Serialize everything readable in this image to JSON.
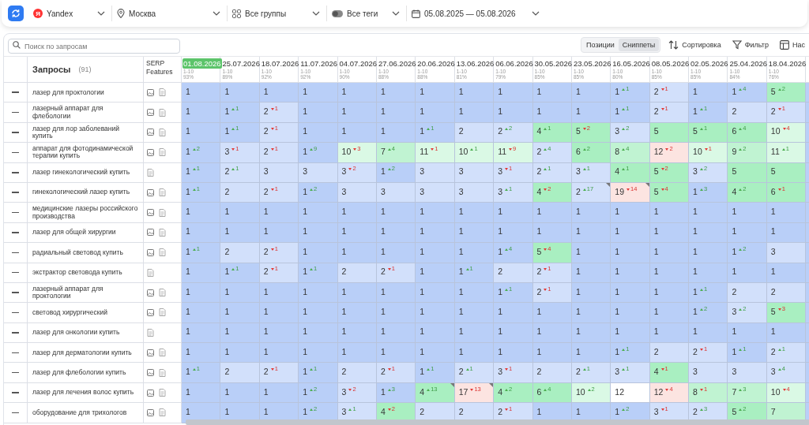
{
  "filters": [
    {
      "kind": "engine",
      "logo": "Я",
      "label": "Yandex"
    },
    {
      "kind": "location",
      "label": "Москва"
    },
    {
      "kind": "groups",
      "label": "Все группы"
    },
    {
      "kind": "tags",
      "label": "Все теги"
    },
    {
      "kind": "dates",
      "label": "05.08.2025 — 05.08.2026"
    }
  ],
  "search": {
    "placeholder": "Поиск по запросам"
  },
  "view_tabs": [
    {
      "label": "Позиции",
      "selected": false
    },
    {
      "label": "Сниппеты",
      "selected": true
    }
  ],
  "actions": [
    {
      "kind": "sort",
      "label": "Сортировка"
    },
    {
      "kind": "filter",
      "label": "Фильтр"
    },
    {
      "kind": "columns",
      "label": "Нас"
    }
  ],
  "table": {
    "query_heading": "Запросы",
    "query_count": "(91)",
    "serp_heading": "SERP Features",
    "columns": [
      {
        "date": "01.08.2026",
        "range": "1-10",
        "share": "93%",
        "selected": true
      },
      {
        "date": "25.07.2026",
        "range": "1-10",
        "share": "89%",
        "selected": false
      },
      {
        "date": "18.07.2026",
        "range": "1-10",
        "share": "92%",
        "selected": false
      },
      {
        "date": "11.07.2026",
        "range": "1-10",
        "share": "92%",
        "selected": false
      },
      {
        "date": "04.07.2026",
        "range": "1-10",
        "share": "90%",
        "selected": false
      },
      {
        "date": "27.06.2026",
        "range": "1-10",
        "share": "88%",
        "selected": false
      },
      {
        "date": "20.06.2026",
        "range": "1-10",
        "share": "88%",
        "selected": false
      },
      {
        "date": "13.06.2026",
        "range": "1-10",
        "share": "81%",
        "selected": false
      },
      {
        "date": "06.06.2026",
        "range": "1-10",
        "share": "79%",
        "selected": false
      },
      {
        "date": "30.05.2026",
        "range": "1-10",
        "share": "85%",
        "selected": false
      },
      {
        "date": "23.05.2026",
        "range": "1-10",
        "share": "85%",
        "selected": false
      },
      {
        "date": "16.05.2026",
        "range": "1-10",
        "share": "80%",
        "selected": false
      },
      {
        "date": "08.05.2026",
        "range": "1-10",
        "share": "85%",
        "selected": false
      },
      {
        "date": "02.05.2026",
        "range": "1-10",
        "share": "85%",
        "selected": false
      },
      {
        "date": "25.04.2026",
        "range": "1-10",
        "share": "84%",
        "selected": false
      },
      {
        "date": "18.04.2026",
        "range": "1-10",
        "share": "76%",
        "selected": false
      }
    ],
    "rows": [
      {
        "query": "лазер для проктологии",
        "images": true,
        "cells": [
          {
            "value": "1"
          },
          {
            "value": "1"
          },
          {
            "value": "1"
          },
          {
            "value": "1"
          },
          {
            "value": "1"
          },
          {
            "value": "1"
          },
          {
            "value": "1"
          },
          {
            "value": "1"
          },
          {
            "value": "1"
          },
          {
            "value": "1"
          },
          {
            "value": "1"
          },
          {
            "value": "1",
            "delta": "1",
            "rising": true
          },
          {
            "value": "2",
            "delta": "1",
            "rising": false
          },
          {
            "value": "1"
          },
          {
            "value": "1",
            "delta": "4",
            "rising": true
          },
          {
            "value": "5",
            "delta": "2",
            "rising": true
          }
        ]
      },
      {
        "query": "лазерный аппарат для флебологии",
        "images": true,
        "cells": [
          {
            "value": "1"
          },
          {
            "value": "1",
            "delta": "1",
            "rising": true
          },
          {
            "value": "2",
            "delta": "1",
            "rising": false
          },
          {
            "value": "1"
          },
          {
            "value": "1"
          },
          {
            "value": "1"
          },
          {
            "value": "1"
          },
          {
            "value": "1"
          },
          {
            "value": "1"
          },
          {
            "value": "1"
          },
          {
            "value": "1"
          },
          {
            "value": "1",
            "delta": "1",
            "rising": true
          },
          {
            "value": "2",
            "delta": "1",
            "rising": false
          },
          {
            "value": "1",
            "delta": "1",
            "rising": true
          },
          {
            "value": "2"
          },
          {
            "value": "2",
            "delta": "1",
            "rising": false
          }
        ]
      },
      {
        "query": "лазер для лор заболеваний купить",
        "images": true,
        "cells": [
          {
            "value": "1"
          },
          {
            "value": "1",
            "delta": "1",
            "rising": true
          },
          {
            "value": "2",
            "delta": "1",
            "rising": false
          },
          {
            "value": "1"
          },
          {
            "value": "1"
          },
          {
            "value": "1"
          },
          {
            "value": "1",
            "delta": "1",
            "rising": true
          },
          {
            "value": "2"
          },
          {
            "value": "2",
            "delta": "2",
            "rising": true
          },
          {
            "value": "4",
            "delta": "1",
            "rising": true
          },
          {
            "value": "5",
            "delta": "2",
            "rising": false
          },
          {
            "value": "3",
            "delta": "2",
            "rising": true
          },
          {
            "value": "5"
          },
          {
            "value": "5",
            "delta": "1",
            "rising": true
          },
          {
            "value": "6",
            "delta": "4",
            "rising": true
          },
          {
            "value": "10",
            "delta": "4",
            "rising": false
          }
        ]
      },
      {
        "query": "аппарат для фотодинамической терапии купить",
        "images": true,
        "cells": [
          {
            "value": "1",
            "delta": "2",
            "rising": true
          },
          {
            "value": "3",
            "delta": "1",
            "rising": false
          },
          {
            "value": "2",
            "delta": "1",
            "rising": false
          },
          {
            "value": "1",
            "delta": "9",
            "rising": true
          },
          {
            "value": "10",
            "delta": "3",
            "rising": false
          },
          {
            "value": "7",
            "delta": "4",
            "rising": true
          },
          {
            "value": "11",
            "delta": "1",
            "rising": false
          },
          {
            "value": "10",
            "delta": "1",
            "rising": true
          },
          {
            "value": "11",
            "delta": "9",
            "rising": false
          },
          {
            "value": "2",
            "delta": "4",
            "rising": true
          },
          {
            "value": "6",
            "delta": "2",
            "rising": true
          },
          {
            "value": "8",
            "delta": "4",
            "rising": true
          },
          {
            "value": "12",
            "delta": "2",
            "rising": false
          },
          {
            "value": "10",
            "delta": "1",
            "rising": false
          },
          {
            "value": "9",
            "delta": "2",
            "rising": true
          },
          {
            "value": "11",
            "delta": "1",
            "rising": true
          }
        ]
      },
      {
        "query": "лазер гинекологический купить",
        "images": false,
        "cells": [
          {
            "value": "1",
            "delta": "1",
            "rising": true
          },
          {
            "value": "2",
            "delta": "1",
            "rising": true
          },
          {
            "value": "3"
          },
          {
            "value": "3"
          },
          {
            "value": "3",
            "delta": "2",
            "rising": false
          },
          {
            "value": "1",
            "delta": "2",
            "rising": true
          },
          {
            "value": "3"
          },
          {
            "value": "3"
          },
          {
            "value": "3",
            "delta": "1",
            "rising": false
          },
          {
            "value": "2",
            "delta": "1",
            "rising": true
          },
          {
            "value": "3",
            "delta": "1",
            "rising": true
          },
          {
            "value": "4",
            "delta": "1",
            "rising": true
          },
          {
            "value": "5",
            "delta": "2",
            "rising": false
          },
          {
            "value": "3",
            "delta": "2",
            "rising": true
          },
          {
            "value": "5"
          },
          {
            "value": "5"
          }
        ]
      },
      {
        "query": "гинекологический лазер купить",
        "images": true,
        "cells": [
          {
            "value": "1",
            "delta": "1",
            "rising": true
          },
          {
            "value": "2"
          },
          {
            "value": "2",
            "delta": "1",
            "rising": false
          },
          {
            "value": "1",
            "delta": "2",
            "rising": true
          },
          {
            "value": "3"
          },
          {
            "value": "3"
          },
          {
            "value": "3"
          },
          {
            "value": "3"
          },
          {
            "value": "3",
            "delta": "1",
            "rising": true
          },
          {
            "value": "4",
            "delta": "2",
            "rising": false
          },
          {
            "value": "2",
            "delta": "17",
            "rising": true,
            "flagged": true
          },
          {
            "value": "19",
            "delta": "14",
            "rising": false,
            "flagged": true
          },
          {
            "value": "5",
            "delta": "4",
            "rising": false
          },
          {
            "value": "1",
            "delta": "3",
            "rising": true
          },
          {
            "value": "4",
            "delta": "2",
            "rising": true
          },
          {
            "value": "6",
            "delta": "1",
            "rising": false
          }
        ]
      },
      {
        "query": "медицинские лазеры российского производства",
        "images": true,
        "cells": [
          {
            "value": "1"
          },
          {
            "value": "1"
          },
          {
            "value": "1"
          },
          {
            "value": "1"
          },
          {
            "value": "1"
          },
          {
            "value": "1"
          },
          {
            "value": "1"
          },
          {
            "value": "1"
          },
          {
            "value": "1"
          },
          {
            "value": "1"
          },
          {
            "value": "1"
          },
          {
            "value": "1"
          },
          {
            "value": "1"
          },
          {
            "value": "1"
          },
          {
            "value": "1"
          },
          {
            "value": "1"
          }
        ]
      },
      {
        "query": "лазер для общей хирургии",
        "images": true,
        "cells": [
          {
            "value": "1"
          },
          {
            "value": "1"
          },
          {
            "value": "1"
          },
          {
            "value": "1"
          },
          {
            "value": "1"
          },
          {
            "value": "1"
          },
          {
            "value": "1"
          },
          {
            "value": "1"
          },
          {
            "value": "1"
          },
          {
            "value": "1"
          },
          {
            "value": "1"
          },
          {
            "value": "1"
          },
          {
            "value": "1"
          },
          {
            "value": "1"
          },
          {
            "value": "1"
          },
          {
            "value": "1"
          }
        ]
      },
      {
        "query": "радиальный световод купить",
        "images": true,
        "cells": [
          {
            "value": "1",
            "delta": "1",
            "rising": true
          },
          {
            "value": "2"
          },
          {
            "value": "2",
            "delta": "1",
            "rising": false
          },
          {
            "value": "1"
          },
          {
            "value": "1"
          },
          {
            "value": "1"
          },
          {
            "value": "1"
          },
          {
            "value": "1"
          },
          {
            "value": "1",
            "delta": "4",
            "rising": true
          },
          {
            "value": "5",
            "delta": "4",
            "rising": false
          },
          {
            "value": "1"
          },
          {
            "value": "1"
          },
          {
            "value": "1"
          },
          {
            "value": "1"
          },
          {
            "value": "1",
            "delta": "2",
            "rising": true
          },
          {
            "value": "3"
          }
        ]
      },
      {
        "query": "экстрактор световода купить",
        "images": false,
        "cells": [
          {
            "value": "1"
          },
          {
            "value": "1",
            "delta": "1",
            "rising": true
          },
          {
            "value": "2",
            "delta": "1",
            "rising": false
          },
          {
            "value": "1",
            "delta": "1",
            "rising": true
          },
          {
            "value": "2"
          },
          {
            "value": "2",
            "delta": "1",
            "rising": false
          },
          {
            "value": "1"
          },
          {
            "value": "1",
            "delta": "1",
            "rising": true
          },
          {
            "value": "2"
          },
          {
            "value": "2",
            "delta": "1",
            "rising": false
          },
          {
            "value": "1"
          },
          {
            "value": "1"
          },
          {
            "value": "1"
          },
          {
            "value": "1"
          },
          {
            "value": "1"
          },
          {
            "value": "1"
          }
        ]
      },
      {
        "query": "лазерный аппарат для проктологии",
        "images": true,
        "cells": [
          {
            "value": "1"
          },
          {
            "value": "1"
          },
          {
            "value": "1"
          },
          {
            "value": "1"
          },
          {
            "value": "1"
          },
          {
            "value": "1"
          },
          {
            "value": "1"
          },
          {
            "value": "1"
          },
          {
            "value": "1",
            "delta": "1",
            "rising": true
          },
          {
            "value": "2",
            "delta": "1",
            "rising": false
          },
          {
            "value": "1"
          },
          {
            "value": "1"
          },
          {
            "value": "1"
          },
          {
            "value": "1",
            "delta": "1",
            "rising": true
          },
          {
            "value": "2"
          },
          {
            "value": "2"
          }
        ]
      },
      {
        "query": "световод хирургический",
        "images": true,
        "cells": [
          {
            "value": "1"
          },
          {
            "value": "1"
          },
          {
            "value": "1"
          },
          {
            "value": "1"
          },
          {
            "value": "1"
          },
          {
            "value": "1"
          },
          {
            "value": "1"
          },
          {
            "value": "1"
          },
          {
            "value": "1"
          },
          {
            "value": "1"
          },
          {
            "value": "1"
          },
          {
            "value": "1"
          },
          {
            "value": "1"
          },
          {
            "value": "1",
            "delta": "2",
            "rising": true
          },
          {
            "value": "3",
            "delta": "2",
            "rising": true
          },
          {
            "value": "5",
            "delta": "3",
            "rising": false
          }
        ]
      },
      {
        "query": "лазер для онкологии купить",
        "images": false,
        "cells": [
          {
            "value": "1"
          },
          {
            "value": "1"
          },
          {
            "value": "1"
          },
          {
            "value": "1"
          },
          {
            "value": "1"
          },
          {
            "value": "1"
          },
          {
            "value": "1"
          },
          {
            "value": "1"
          },
          {
            "value": "1"
          },
          {
            "value": "1"
          },
          {
            "value": "1"
          },
          {
            "value": "1"
          },
          {
            "value": "1"
          },
          {
            "value": "1"
          },
          {
            "value": "1"
          },
          {
            "value": "1"
          }
        ]
      },
      {
        "query": "лазер для дерматологии купить",
        "images": true,
        "cells": [
          {
            "value": "1"
          },
          {
            "value": "1"
          },
          {
            "value": "1"
          },
          {
            "value": "1"
          },
          {
            "value": "1"
          },
          {
            "value": "1"
          },
          {
            "value": "1"
          },
          {
            "value": "1"
          },
          {
            "value": "1"
          },
          {
            "value": "1"
          },
          {
            "value": "1"
          },
          {
            "value": "1",
            "delta": "1",
            "rising": true
          },
          {
            "value": "2"
          },
          {
            "value": "2",
            "delta": "1",
            "rising": false
          },
          {
            "value": "1",
            "delta": "1",
            "rising": true
          },
          {
            "value": "2",
            "delta": "1",
            "rising": true
          }
        ]
      },
      {
        "query": "лазер для флебологии купить",
        "images": true,
        "cells": [
          {
            "value": "1",
            "delta": "1",
            "rising": true
          },
          {
            "value": "2"
          },
          {
            "value": "2",
            "delta": "1",
            "rising": false
          },
          {
            "value": "1",
            "delta": "1",
            "rising": true
          },
          {
            "value": "2"
          },
          {
            "value": "2",
            "delta": "1",
            "rising": false
          },
          {
            "value": "1",
            "delta": "1",
            "rising": true
          },
          {
            "value": "2",
            "delta": "1",
            "rising": true
          },
          {
            "value": "3",
            "delta": "1",
            "rising": false
          },
          {
            "value": "2"
          },
          {
            "value": "2",
            "delta": "1",
            "rising": true
          },
          {
            "value": "3",
            "delta": "1",
            "rising": true
          },
          {
            "value": "4",
            "delta": "1",
            "rising": false
          },
          {
            "value": "3"
          },
          {
            "value": "3"
          },
          {
            "value": "3",
            "delta": "4",
            "rising": true
          }
        ]
      },
      {
        "query": "лазер для лечения волос купить",
        "images": true,
        "cells": [
          {
            "value": "1"
          },
          {
            "value": "1"
          },
          {
            "value": "1"
          },
          {
            "value": "1",
            "delta": "2",
            "rising": true
          },
          {
            "value": "3",
            "delta": "2",
            "rising": false
          },
          {
            "value": "1",
            "delta": "3",
            "rising": true
          },
          {
            "value": "4",
            "delta": "13",
            "rising": true,
            "flagged": true
          },
          {
            "value": "17",
            "delta": "13",
            "rising": false,
            "flagged": true
          },
          {
            "value": "4",
            "delta": "2",
            "rising": true
          },
          {
            "value": "6",
            "delta": "4",
            "rising": true
          },
          {
            "value": "10",
            "delta": "2",
            "rising": true
          },
          {
            "value": "12"
          },
          {
            "value": "12",
            "delta": "4",
            "rising": false
          },
          {
            "value": "8",
            "delta": "1",
            "rising": false
          },
          {
            "value": "7",
            "delta": "3",
            "rising": true
          },
          {
            "value": "10",
            "delta": "4",
            "rising": false
          }
        ]
      },
      {
        "query": "оборудование для трихологов",
        "images": true,
        "cells": [
          {
            "value": "1"
          },
          {
            "value": "1"
          },
          {
            "value": "1"
          },
          {
            "value": "1",
            "delta": "2",
            "rising": true
          },
          {
            "value": "3",
            "delta": "1",
            "rising": true
          },
          {
            "value": "4",
            "delta": "2",
            "rising": false
          },
          {
            "value": "2"
          },
          {
            "value": "2"
          },
          {
            "value": "2",
            "delta": "1",
            "rising": false
          },
          {
            "value": "1"
          },
          {
            "value": "1"
          },
          {
            "value": "1",
            "delta": "2",
            "rising": true
          },
          {
            "value": "3",
            "delta": "1",
            "rising": false
          },
          {
            "value": "2",
            "delta": "3",
            "rising": true
          },
          {
            "value": "5",
            "delta": "2",
            "rising": true
          },
          {
            "value": "7"
          }
        ]
      }
    ]
  }
}
